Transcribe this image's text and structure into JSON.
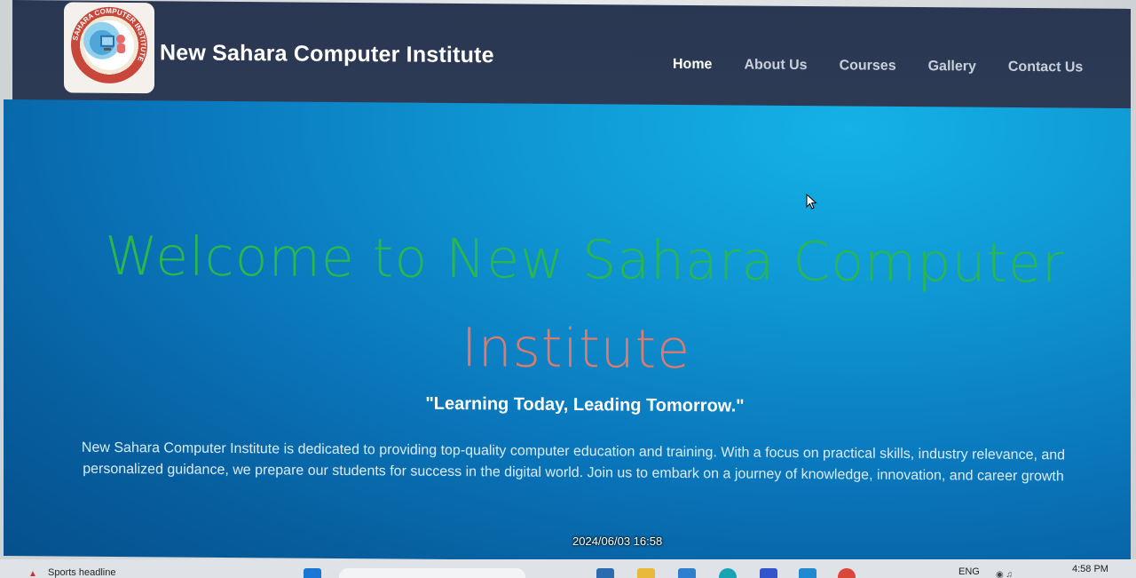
{
  "header": {
    "site_title": "New Sahara Computer Institute",
    "logo": {
      "ring_text": "SAHARA COMPUTER INSTITUTE"
    },
    "nav": [
      {
        "label": "Home",
        "active": true
      },
      {
        "label": "About Us",
        "active": false
      },
      {
        "label": "Courses",
        "active": false
      },
      {
        "label": "Gallery",
        "active": false
      },
      {
        "label": "Contact Us",
        "active": false
      }
    ]
  },
  "hero": {
    "title_part1": "Welcome to New Sahara Computer",
    "title_part2": "Institute",
    "tagline": "\"Learning Today, Leading Tomorrow.\"",
    "description": "New Sahara Computer Institute is dedicated to providing top-quality computer education and training. With a focus on practical skills, industry relevance, and personalized guidance, we prepare our students for success in the digital world. Join us to embark on a journey of knowledge, innovation, and career growth"
  },
  "photo_timestamp": "2024/06/03 16:58",
  "taskbar": {
    "news": "Sports headline",
    "language": "ENG",
    "time": "4:58 PM"
  },
  "colors": {
    "header_bg": "#2e3b55",
    "hero_bg": "#0a78bd",
    "title_green": "#2ab84a",
    "title_salmon": "#e07a6a"
  }
}
